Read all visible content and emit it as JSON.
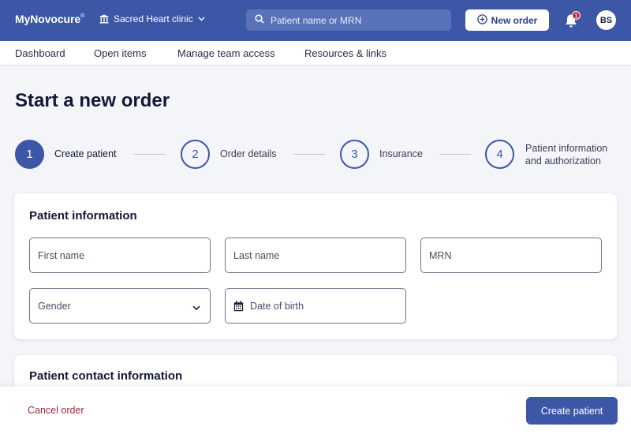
{
  "header": {
    "logo": "MyNovocure",
    "logo_mark": "®",
    "clinic": "Sacred Heart clinic",
    "search_placeholder": "Patient name or MRN",
    "new_order_label": "New order",
    "notification_count": "1",
    "avatar_initials": "BS"
  },
  "nav": {
    "items": [
      "Dashboard",
      "Open items",
      "Manage team access",
      "Resources & links"
    ]
  },
  "page": {
    "title": "Start a new order"
  },
  "steps": [
    {
      "number": "1",
      "label": "Create patient",
      "active": true
    },
    {
      "number": "2",
      "label": "Order details",
      "active": false
    },
    {
      "number": "3",
      "label": "Insurance",
      "active": false
    },
    {
      "number": "4",
      "label_line1": "Patient information",
      "label_line2": "and authorization",
      "active": false
    }
  ],
  "patient_info": {
    "heading": "Patient information",
    "first_name_placeholder": "First name",
    "last_name_placeholder": "Last name",
    "mrn_placeholder": "MRN",
    "gender_selected": "Gender",
    "dob_placeholder": "Date of birth"
  },
  "contact_info": {
    "heading": "Patient contact information"
  },
  "footer": {
    "cancel_label": "Cancel order",
    "create_label": "Create patient"
  },
  "colors": {
    "brand": "#3b57a6",
    "cancel": "#a3283a",
    "badge": "#c62f3c"
  }
}
